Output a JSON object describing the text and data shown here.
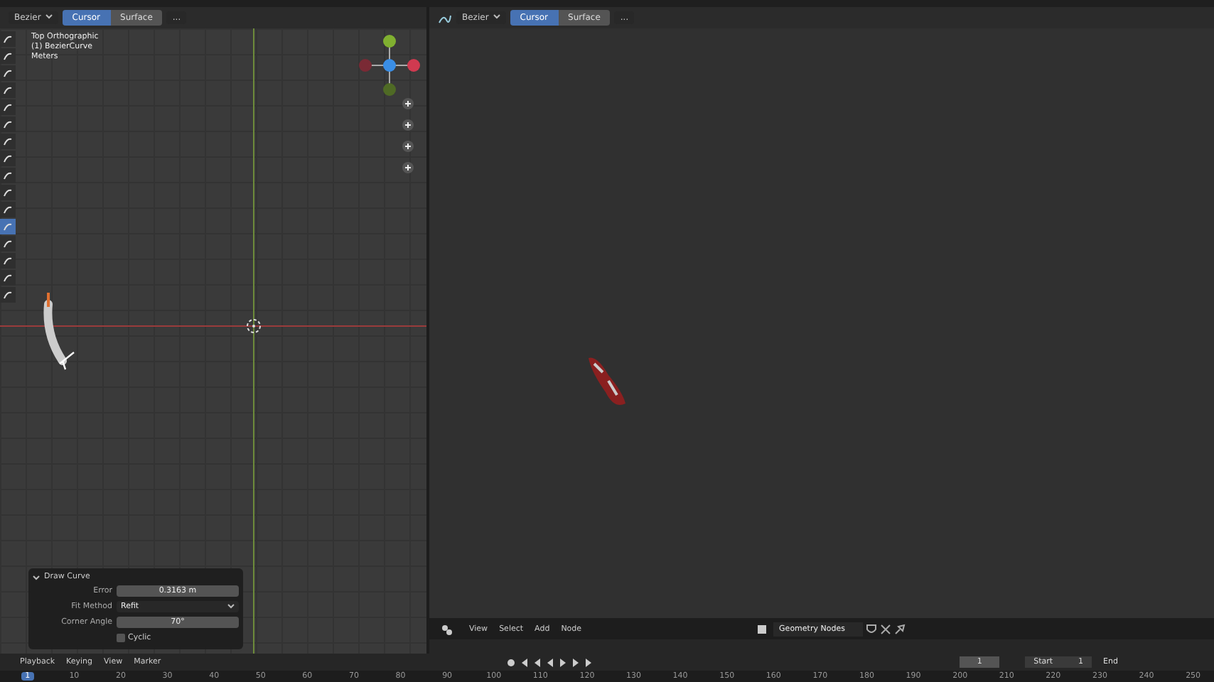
{
  "left_header": {
    "mode": "Bezier",
    "buttons": [
      {
        "label": "Cursor",
        "selected": true
      },
      {
        "label": "Surface",
        "selected": false
      }
    ],
    "more": "..."
  },
  "left_viewport": {
    "overlay": [
      "Top Orthographic",
      "(1) BezierCurve",
      "Meters"
    ]
  },
  "operator_panel": {
    "title": "Draw Curve",
    "expanded": true,
    "fields": [
      {
        "label": "Error",
        "value": "0.3163 m",
        "kind": "number"
      },
      {
        "label": "Fit Method",
        "value": "Refit",
        "kind": "dropdown"
      },
      {
        "label": "Corner Angle",
        "value": "70°",
        "kind": "number"
      },
      {
        "label": "Cyclic",
        "kind": "checkbox",
        "checked": false
      }
    ]
  },
  "right_header": {
    "mode": "Bezier",
    "buttons": [
      {
        "label": "Cursor",
        "selected": true
      },
      {
        "label": "Surface",
        "selected": false
      }
    ],
    "more": "..."
  },
  "node_editor_header": {
    "menus": [
      "View",
      "Select",
      "Add",
      "Node"
    ],
    "node_tree": "Geometry Nodes"
  },
  "timeline": {
    "menus": [
      "Playback",
      "Keying",
      "View",
      "Marker"
    ],
    "current_frame": "1",
    "start_label": "Start",
    "start": "1",
    "end_label": "End",
    "ruler": [
      {
        "label": "1",
        "selected": true
      },
      {
        "label": "10",
        "selected": false
      },
      {
        "label": "20",
        "selected": false
      },
      {
        "label": "30",
        "selected": false
      },
      {
        "label": "40",
        "selected": false
      },
      {
        "label": "50",
        "selected": false
      },
      {
        "label": "60",
        "selected": false
      },
      {
        "label": "70",
        "selected": false
      },
      {
        "label": "80",
        "selected": false
      },
      {
        "label": "90",
        "selected": false
      },
      {
        "label": "100",
        "selected": false
      },
      {
        "label": "110",
        "selected": false
      },
      {
        "label": "120",
        "selected": false
      },
      {
        "label": "130",
        "selected": false
      },
      {
        "label": "140",
        "selected": false
      },
      {
        "label": "150",
        "selected": false
      },
      {
        "label": "160",
        "selected": false
      },
      {
        "label": "170",
        "selected": false
      },
      {
        "label": "180",
        "selected": false
      },
      {
        "label": "190",
        "selected": false
      },
      {
        "label": "200",
        "selected": false
      },
      {
        "label": "210",
        "selected": false
      },
      {
        "label": "220",
        "selected": false
      },
      {
        "label": "230",
        "selected": false
      },
      {
        "label": "240",
        "selected": false
      },
      {
        "label": "250",
        "selected": false
      }
    ]
  }
}
